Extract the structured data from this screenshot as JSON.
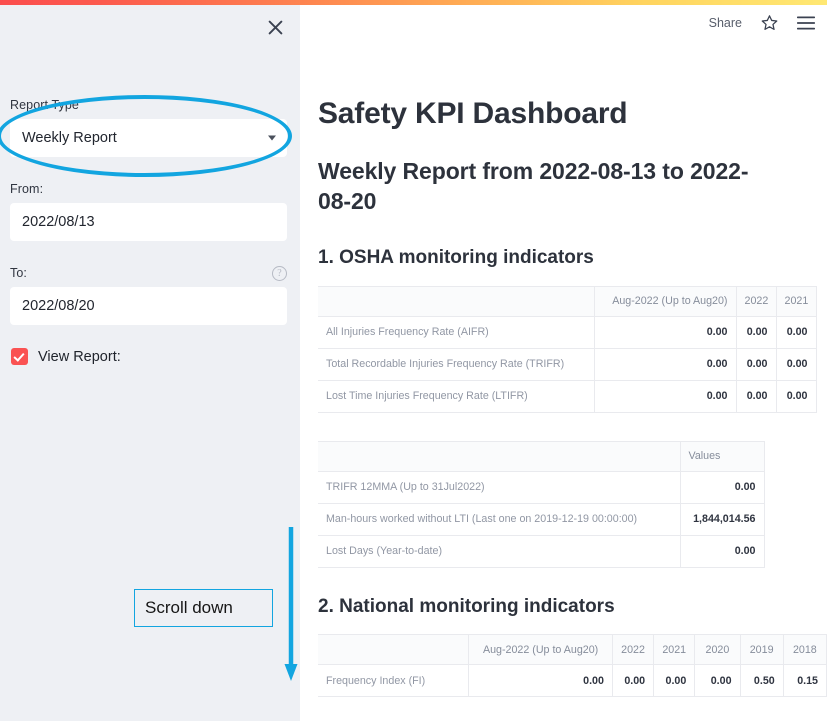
{
  "window": {
    "accent_gradient_from": "#fb4d4d",
    "accent_gradient_to": "#ffe873"
  },
  "sidebar": {
    "close_icon": "close-icon",
    "report_type": {
      "label": "Report Type",
      "value": "Weekly Report",
      "caret_icon": "chevron-down-icon"
    },
    "from": {
      "label": "From:",
      "value": "2022/08/13"
    },
    "to": {
      "label": "To:",
      "value": "2022/08/20",
      "help_icon": "question-circle-icon"
    },
    "view_report": {
      "label": "View Report:",
      "checked": true,
      "checkbox_color": "#fa5252"
    }
  },
  "annotations": {
    "color": "#12a5e0",
    "ellipse_target": "report-type-select",
    "callout_text": "Scroll down",
    "arrow_direction": "down"
  },
  "toolbar": {
    "share_label": "Share",
    "star_icon": "star-icon",
    "menu_icon": "hamburger-menu-icon"
  },
  "report": {
    "title": "Safety KPI Dashboard",
    "subtitle": "Weekly Report from 2022-08-13 to 2022-08-20",
    "sections": [
      {
        "heading": "1. OSHA monitoring indicators",
        "tables": [
          {
            "id": "table-osha",
            "headers": [
              "",
              "Aug-2022 (Up to Aug20)",
              "2022",
              "2021"
            ],
            "rows": [
              {
                "label": "All Injuries Frequency Rate (AIFR)",
                "values": [
                  "0.00",
                  "0.00",
                  "0.00"
                ]
              },
              {
                "label": "Total Recordable Injuries Frequency Rate (TRIFR)",
                "values": [
                  "0.00",
                  "0.00",
                  "0.00"
                ]
              },
              {
                "label": "Lost Time Injuries Frequency Rate (LTIFR)",
                "values": [
                  "0.00",
                  "0.00",
                  "0.00"
                ]
              }
            ]
          },
          {
            "id": "table-values",
            "headers": [
              "",
              "Values"
            ],
            "rows": [
              {
                "label": "TRIFR 12MMA (Up to 31Jul2022)",
                "values": [
                  "0.00"
                ]
              },
              {
                "label": "Man-hours worked without LTI (Last one on 2019-12-19 00:00:00)",
                "values": [
                  "1,844,014.56"
                ]
              },
              {
                "label": "Lost Days (Year-to-date)",
                "values": [
                  "0.00"
                ]
              }
            ]
          }
        ]
      },
      {
        "heading": "2. National monitoring indicators",
        "tables": [
          {
            "id": "table-national",
            "headers": [
              "",
              "Aug-2022 (Up to Aug20)",
              "2022",
              "2021",
              "2020",
              "2019",
              "2018"
            ],
            "rows": [
              {
                "label": "Frequency Index (FI)",
                "values": [
                  "0.00",
                  "0.00",
                  "0.00",
                  "0.00",
                  "0.50",
                  "0.15"
                ]
              }
            ]
          }
        ]
      }
    ]
  }
}
